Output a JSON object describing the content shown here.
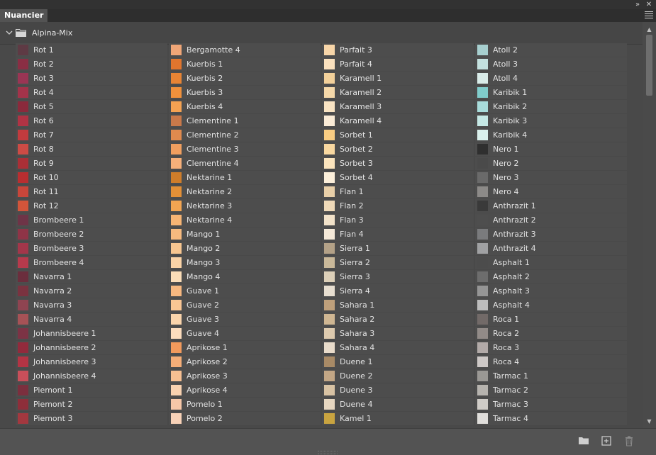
{
  "panel": {
    "tab_label": "Nuancier",
    "group_name": "Alpina-Mix"
  },
  "colors": {
    "topbar": "#323232",
    "panel_bg": "#535353",
    "row_bg": "#4d4d4d",
    "text": "#e3e3e3"
  },
  "swatch_columns": [
    [
      {
        "name": "Rot 1",
        "color": "#5e3a44"
      },
      {
        "name": "Rot 2",
        "color": "#8a2e44"
      },
      {
        "name": "Rot 3",
        "color": "#9a3554"
      },
      {
        "name": "Rot 4",
        "color": "#a3334a"
      },
      {
        "name": "Rot 5",
        "color": "#8b2a3c"
      },
      {
        "name": "Rot 6",
        "color": "#b03344"
      },
      {
        "name": "Rot 7",
        "color": "#c23b3e"
      },
      {
        "name": "Rot 8",
        "color": "#cc4b45"
      },
      {
        "name": "Rot 9",
        "color": "#aa2f36"
      },
      {
        "name": "Rot 10",
        "color": "#b92e30"
      },
      {
        "name": "Rot 11",
        "color": "#c8463a"
      },
      {
        "name": "Rot 12",
        "color": "#d2553a"
      },
      {
        "name": "Brombeere 1",
        "color": "#6e3447"
      },
      {
        "name": "Brombeere 2",
        "color": "#8f3447"
      },
      {
        "name": "Brombeere 3",
        "color": "#a3364a"
      },
      {
        "name": "Brombeere 4",
        "color": "#b73a4c"
      },
      {
        "name": "Navarra 1",
        "color": "#6b2e3d"
      },
      {
        "name": "Navarra 2",
        "color": "#7a3340"
      },
      {
        "name": "Navarra 3",
        "color": "#8f4451"
      },
      {
        "name": "Navarra 4",
        "color": "#a65256"
      },
      {
        "name": "Johannisbeere 1",
        "color": "#7c3345"
      },
      {
        "name": "Johannisbeere 2",
        "color": "#922a3c"
      },
      {
        "name": "Johannisbeere 3",
        "color": "#b33444"
      },
      {
        "name": "Johannisbeere 4",
        "color": "#c94f5a"
      },
      {
        "name": "Piemont 1",
        "color": "#7b2f3e"
      },
      {
        "name": "Piemont 2",
        "color": "#8e2e3a"
      },
      {
        "name": "Piemont 3",
        "color": "#a3383f"
      }
    ],
    [
      {
        "name": "Bergamotte 4",
        "color": "#f0a677"
      },
      {
        "name": "Kuerbis 1",
        "color": "#e0752e"
      },
      {
        "name": "Kuerbis 2",
        "color": "#e88434"
      },
      {
        "name": "Kuerbis 3",
        "color": "#f0913c"
      },
      {
        "name": "Kuerbis 4",
        "color": "#f4a252"
      },
      {
        "name": "Clementine 1",
        "color": "#c9794a"
      },
      {
        "name": "Clementine 2",
        "color": "#df8a4e"
      },
      {
        "name": "Clementine 3",
        "color": "#f19f5f"
      },
      {
        "name": "Clementine 4",
        "color": "#f6b07a"
      },
      {
        "name": "Nektarine 1",
        "color": "#cf7d2a"
      },
      {
        "name": "Nektarine 2",
        "color": "#e39037"
      },
      {
        "name": "Nektarine 3",
        "color": "#f3a552"
      },
      {
        "name": "Nektarine 4",
        "color": "#f8b574"
      },
      {
        "name": "Mango 1",
        "color": "#f6ba7f"
      },
      {
        "name": "Mango 2",
        "color": "#f8c690"
      },
      {
        "name": "Mango 3",
        "color": "#fad3a7"
      },
      {
        "name": "Mango 4",
        "color": "#fbddb8"
      },
      {
        "name": "Guave 1",
        "color": "#f7b880"
      },
      {
        "name": "Guave 2",
        "color": "#f9c694"
      },
      {
        "name": "Guave 3",
        "color": "#fad4ab"
      },
      {
        "name": "Guave 4",
        "color": "#fbdcbd"
      },
      {
        "name": "Aprikose 1",
        "color": "#f29a5c"
      },
      {
        "name": "Aprikose 2",
        "color": "#f5ae78"
      },
      {
        "name": "Aprikose 3",
        "color": "#f7c092"
      },
      {
        "name": "Aprikose 4",
        "color": "#f9d2b0"
      },
      {
        "name": "Pomelo 1",
        "color": "#f6c7a8"
      },
      {
        "name": "Pomelo 2",
        "color": "#f8d2b8"
      }
    ],
    [
      {
        "name": "Parfait 3",
        "color": "#f7d5a8"
      },
      {
        "name": "Parfait 4",
        "color": "#f9e0bd"
      },
      {
        "name": "Karamell 1",
        "color": "#f2d09a"
      },
      {
        "name": "Karamell 2",
        "color": "#f5d8a9"
      },
      {
        "name": "Karamell 3",
        "color": "#f8e3c2"
      },
      {
        "name": "Karamell 4",
        "color": "#faebd6"
      },
      {
        "name": "Sorbet 1",
        "color": "#f8cc82"
      },
      {
        "name": "Sorbet 2",
        "color": "#f9d8a0"
      },
      {
        "name": "Sorbet 3",
        "color": "#fbe4bd"
      },
      {
        "name": "Sorbet 4",
        "color": "#fcefda"
      },
      {
        "name": "Flan 1",
        "color": "#e8cfa8"
      },
      {
        "name": "Flan 2",
        "color": "#eed9b8"
      },
      {
        "name": "Flan 3",
        "color": "#f2e2c9"
      },
      {
        "name": "Flan 4",
        "color": "#f5e9d8"
      },
      {
        "name": "Sierra 1",
        "color": "#b3a187"
      },
      {
        "name": "Sierra 2",
        "color": "#c9b899"
      },
      {
        "name": "Sierra 3",
        "color": "#dccfb8"
      },
      {
        "name": "Sierra 4",
        "color": "#e7ded0"
      },
      {
        "name": "Sahara 1",
        "color": "#bfa07b"
      },
      {
        "name": "Sahara 2",
        "color": "#cfb692"
      },
      {
        "name": "Sahara 3",
        "color": "#ddcaae"
      },
      {
        "name": "Sahara 4",
        "color": "#e9dccb"
      },
      {
        "name": "Duene 1",
        "color": "#a88a66"
      },
      {
        "name": "Duene 2",
        "color": "#c2a685"
      },
      {
        "name": "Duene 3",
        "color": "#d8c2a3"
      },
      {
        "name": "Duene 4",
        "color": "#e6d6c0"
      },
      {
        "name": "Kamel 1",
        "color": "#c9a440"
      }
    ],
    [
      {
        "name": "Atoll 2",
        "color": "#a7cfcf"
      },
      {
        "name": "Atoll 3",
        "color": "#c4e1df"
      },
      {
        "name": "Atoll 4",
        "color": "#d9ece9"
      },
      {
        "name": "Karibik 1",
        "color": "#80cccb"
      },
      {
        "name": "Karibik 2",
        "color": "#a8dcdb"
      },
      {
        "name": "Karibik 3",
        "color": "#c5e8e5"
      },
      {
        "name": "Karibik 4",
        "color": "#daf0ec"
      },
      {
        "name": "Nero 1",
        "color": "#2f2f2f"
      },
      {
        "name": "Nero 2",
        "color": "#4a4a4a"
      },
      {
        "name": "Nero 3",
        "color": "#6a6a6a"
      },
      {
        "name": "Nero 4",
        "color": "#8c8a88"
      },
      {
        "name": "Anthrazit 1",
        "color": "#3a3a3a"
      },
      {
        "name": "Anthrazit 2",
        "color": "#4e4e4e"
      },
      {
        "name": "Anthrazit 3",
        "color": "#7a7b7d"
      },
      {
        "name": "Anthrazit 4",
        "color": "#a0a1a3"
      },
      {
        "name": "Asphalt 1",
        "color": "#4c4c4c"
      },
      {
        "name": "Asphalt 2",
        "color": "#6d6d6d"
      },
      {
        "name": "Asphalt 3",
        "color": "#959595"
      },
      {
        "name": "Asphalt 4",
        "color": "#bdbdbd"
      },
      {
        "name": "Roca 1",
        "color": "#726a68"
      },
      {
        "name": "Roca 2",
        "color": "#928b88"
      },
      {
        "name": "Roca 3",
        "color": "#b2aaa8"
      },
      {
        "name": "Roca 4",
        "color": "#cdc8c6"
      },
      {
        "name": "Tarmac 1",
        "color": "#9a9894"
      },
      {
        "name": "Tarmac 2",
        "color": "#b6b3ae"
      },
      {
        "name": "Tarmac 3",
        "color": "#cfccc7"
      },
      {
        "name": "Tarmac 4",
        "color": "#e0dedb"
      }
    ]
  ]
}
